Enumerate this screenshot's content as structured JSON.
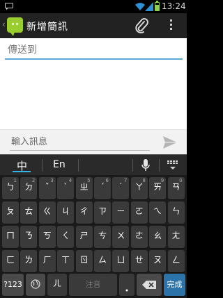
{
  "status_bar": {
    "time": "13:24",
    "battery_level": 0.7
  },
  "action_bar": {
    "title": "新增簡訊"
  },
  "recipient": {
    "placeholder": "傳送到"
  },
  "compose": {
    "placeholder": "輸入訊息"
  },
  "keyboard": {
    "modes": {
      "chinese": "中",
      "english": "En"
    },
    "rows": [
      [
        {
          "k": "ㄅ",
          "s": "1"
        },
        {
          "k": "ㄉ",
          "s": "2"
        },
        {
          "k": "ˇ",
          "s": "3"
        },
        {
          "k": "ˋ",
          "s": "4"
        },
        {
          "k": "ㄓ",
          "s": "5"
        },
        {
          "k": "ˊ",
          "s": "6"
        },
        {
          "k": "˙",
          "s": "7"
        },
        {
          "k": "ㄚ",
          "s": "8"
        },
        {
          "k": "ㄞ",
          "s": "9"
        },
        {
          "k": "ㄢ",
          "s": "0"
        }
      ],
      [
        {
          "k": "ㄆ",
          "s": ""
        },
        {
          "k": "ㄊ",
          "s": ""
        },
        {
          "k": "ㄍ",
          "s": ""
        },
        {
          "k": "ㄐ",
          "s": ""
        },
        {
          "k": "ㄔ",
          "s": ""
        },
        {
          "k": "ㄗ",
          "s": ""
        },
        {
          "k": "ㄧ",
          "s": ""
        },
        {
          "k": "ㄛ",
          "s": ""
        },
        {
          "k": "ㄟ",
          "s": ""
        },
        {
          "k": "ㄣ",
          "s": ""
        }
      ],
      [
        {
          "k": "ㄇ",
          "s": ""
        },
        {
          "k": "ㄋ",
          "s": ""
        },
        {
          "k": "ㄎ",
          "s": ""
        },
        {
          "k": "ㄑ",
          "s": ""
        },
        {
          "k": "ㄕ",
          "s": ""
        },
        {
          "k": "ㄘ",
          "s": ""
        },
        {
          "k": "ㄨ",
          "s": ""
        },
        {
          "k": "ㄜ",
          "s": ""
        },
        {
          "k": "ㄠ",
          "s": ""
        },
        {
          "k": "ㄤ",
          "s": ""
        }
      ],
      [
        {
          "k": "ㄈ",
          "s": ""
        },
        {
          "k": "ㄌ",
          "s": ""
        },
        {
          "k": "ㄏ",
          "s": ""
        },
        {
          "k": "ㄒ",
          "s": ""
        },
        {
          "k": "ㄖ",
          "s": ""
        },
        {
          "k": "ㄙ",
          "s": ""
        },
        {
          "k": "ㄩ",
          "s": ""
        },
        {
          "k": "ㄝ",
          "s": ""
        },
        {
          "k": "ㄡ",
          "s": ""
        },
        {
          "k": "ㄥ",
          "s": ""
        }
      ]
    ],
    "bottom": {
      "symbols": "?123",
      "er": "ㄦ",
      "space": "注音",
      "done": "完成"
    }
  }
}
